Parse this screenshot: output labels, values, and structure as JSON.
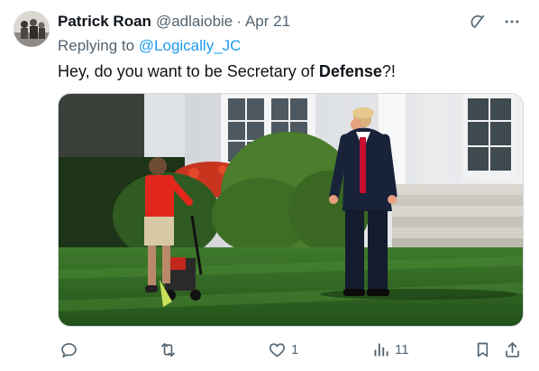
{
  "tweet": {
    "display_name": "Patrick Roan",
    "handle": "@adlaiobie",
    "separator": "·",
    "date": "Apr 21",
    "replying_to_prefix": "Replying to ",
    "replying_to_handle": "@Logically_JC",
    "text_before": "Hey, do you want to be Secretary of ",
    "text_bold": "Defense",
    "text_after": "?!"
  },
  "header_icons": [
    "grok-icon",
    "more-icon"
  ],
  "actions": {
    "reply_count": "",
    "retweet_count": "",
    "like_count": "1",
    "views_count": "11"
  },
  "colors": {
    "text_primary": "#0f1419",
    "text_secondary": "#536471",
    "link": "#1d9bf0",
    "border": "#cfd9de"
  }
}
